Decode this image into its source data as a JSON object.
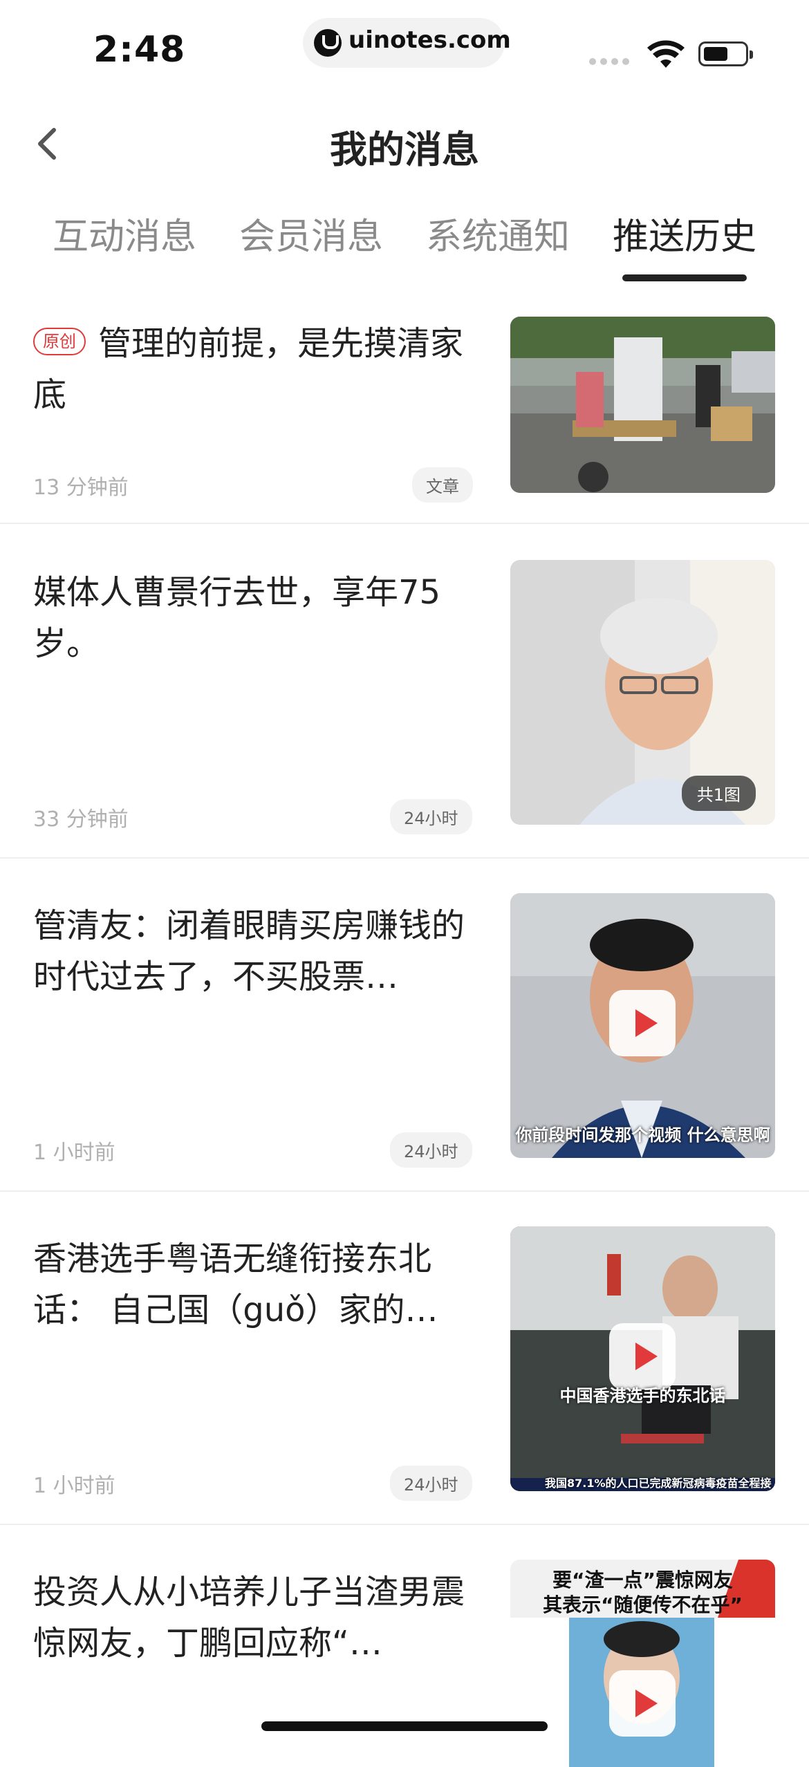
{
  "status_bar": {
    "time": "2:48",
    "url": "uinotes.com"
  },
  "header": {
    "title": "我的消息",
    "back_icon": "chevron-left-icon"
  },
  "tabs": [
    {
      "label": "互动消息",
      "active": false
    },
    {
      "label": "会员消息",
      "active": false
    },
    {
      "label": "系统通知",
      "active": false
    },
    {
      "label": "推送历史",
      "active": true
    }
  ],
  "items": [
    {
      "badge": "原创",
      "title": "管理的前提，是先摸清家底",
      "time": "13 分钟前",
      "tag": "文章",
      "thumb_type": "photo"
    },
    {
      "title": "媒体人曹景行去世，享年75岁。",
      "time": "33 分钟前",
      "tag": "24小时",
      "thumb_type": "photo",
      "image_count": "共1图"
    },
    {
      "title": "管清友：闭着眼睛买房赚钱的时代过去了，不买股票…",
      "time": "1 小时前",
      "tag": "24小时",
      "thumb_type": "video",
      "caption": "你前段时间发那个视频 什么意思啊"
    },
    {
      "title": "香港选手粤语无缝衔接东北话： 自己国（guǒ）家的…",
      "time": "1 小时前",
      "tag": "24小时",
      "thumb_type": "video",
      "caption": "中国香港选手的东北话",
      "ticker": "我国87.1%的人口已完成新冠病毒疫苗全程接"
    },
    {
      "title": "投资人从小培养儿子当渣男震惊网友，丁鹏回应称“…",
      "thumb_type": "video",
      "caption_top": "要“渣一点”震惊网友",
      "caption_top2": "其表示“随便传不在乎”"
    }
  ],
  "colors": {
    "accent": "#e23a3a",
    "text_primary": "#222222",
    "text_secondary": "#b0b0b0",
    "tab_inactive": "#8a8a8a"
  }
}
